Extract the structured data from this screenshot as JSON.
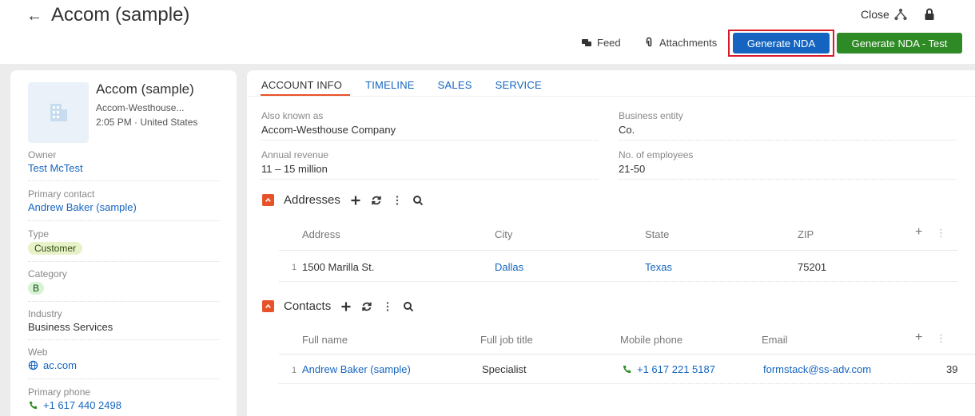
{
  "header": {
    "back_icon": "arrow-left-icon",
    "title": "Accom (sample)",
    "close_label": "Close",
    "feed_label": "Feed",
    "attachments_label": "Attachments",
    "generate_nda_label": "Generate NDA",
    "generate_nda_test_label": "Generate NDA - Test",
    "nda_button_color": "#1565c0",
    "nda_test_button_color": "#2e8a25",
    "highlight_color": "#d81b2a"
  },
  "sidebar": {
    "account_name": "Accom (sample)",
    "account_subtitle": "Accom-Westhouse...",
    "account_time": "2:05 PM · United States",
    "owner_label": "Owner",
    "owner_value": "Test McTest",
    "primary_contact_label": "Primary contact",
    "primary_contact_value": "Andrew Baker (sample)",
    "type_label": "Type",
    "type_value": "Customer",
    "category_label": "Category",
    "category_value": "B",
    "industry_label": "Industry",
    "industry_value": "Business Services",
    "web_label": "Web",
    "web_value": "ac.com",
    "primary_phone_label": "Primary phone",
    "primary_phone_value": "+1 617 440 2498"
  },
  "tabs": [
    {
      "label": "ACCOUNT INFO",
      "active": true
    },
    {
      "label": "TIMELINE",
      "active": false
    },
    {
      "label": "SALES",
      "active": false
    },
    {
      "label": "SERVICE",
      "active": false
    }
  ],
  "account_info": {
    "also_known_as_label": "Also known as",
    "also_known_as_value": "Accom-Westhouse Company",
    "business_entity_label": "Business entity",
    "business_entity_value": "Co.",
    "annual_revenue_label": "Annual revenue",
    "annual_revenue_value": "11 – 15 million",
    "employees_label": "No. of employees",
    "employees_value": "21-50"
  },
  "addresses": {
    "title": "Addresses",
    "columns": [
      "Address",
      "City",
      "State",
      "ZIP"
    ],
    "rows": [
      {
        "num": "1",
        "address": "1500 Marilla St.",
        "city": "Dallas",
        "state": "Texas",
        "zip": "75201"
      }
    ]
  },
  "contacts": {
    "title": "Contacts",
    "columns": [
      "Full name",
      "Full job title",
      "Mobile phone",
      "Email"
    ],
    "rows": [
      {
        "num": "1",
        "full_name": "Andrew Baker (sample)",
        "job_title": "Specialist",
        "mobile": "+1 617 221 5187",
        "email": "formstack@ss-adv.com",
        "extra": "39"
      }
    ]
  },
  "accent_color": "#e8522a",
  "link_color": "#1565c0"
}
